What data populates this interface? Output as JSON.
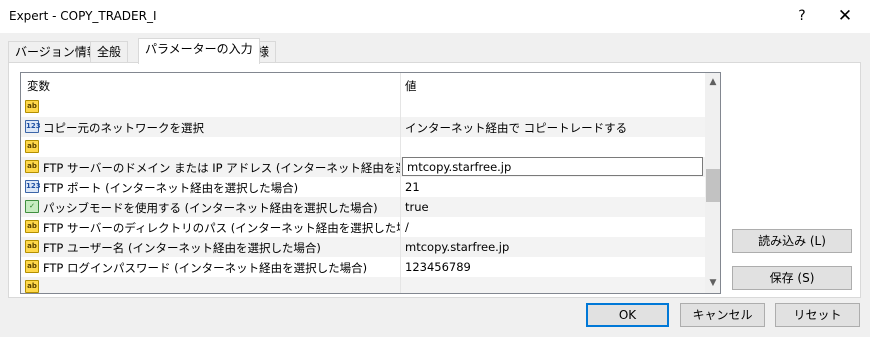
{
  "window": {
    "title": "Expert - COPY_TRADER_I",
    "help": "?",
    "close": "✕"
  },
  "tabs": [
    {
      "label": "バージョン情報"
    },
    {
      "label": "全般"
    },
    {
      "label": "パラメーターの入力"
    },
    {
      "label": "仕様"
    }
  ],
  "grid": {
    "columns": {
      "name": "変数",
      "value": "値"
    },
    "rows": [
      {
        "icon": "string-icon",
        "name": "",
        "value": ""
      },
      {
        "icon": "integer-icon",
        "name": "コピー元のネットワークを選択",
        "value": "インターネット経由で コピートレードする"
      },
      {
        "icon": "string-icon",
        "name": "",
        "value": ""
      },
      {
        "icon": "string-icon",
        "name": "FTP サーバーのドメイン または IP アドレス (インターネット経由を選択した場合)",
        "value": "mtcopy.starfree.jp"
      },
      {
        "icon": "integer-icon",
        "name": "FTP ポート (インターネット経由を選択した場合)",
        "value": "21"
      },
      {
        "icon": "bool-icon",
        "name": "パッシブモードを使用する (インターネット経由を選択した場合)",
        "value": "true"
      },
      {
        "icon": "string-icon",
        "name": "FTP サーバーのディレクトリのパス (インターネット経由を選択した場合)",
        "value": "/"
      },
      {
        "icon": "string-icon",
        "name": "FTP ユーザー名 (インターネット経由を選択した場合)",
        "value": "mtcopy.starfree.jp"
      },
      {
        "icon": "string-icon",
        "name": "FTP ログインパスワード (インターネット経由を選択した場合)",
        "value": "123456789"
      },
      {
        "icon": "string-icon",
        "name": "",
        "value": ""
      }
    ],
    "icon_glyphs": {
      "string": "ab",
      "integer": "123",
      "bool": "✓"
    }
  },
  "side_buttons": {
    "load": "読み込み (L)",
    "save": "保存 (S)"
  },
  "footer": {
    "ok": "OK",
    "cancel": "キャンセル",
    "reset": "リセット"
  },
  "scrollbar": {
    "up": "▲",
    "down": "▼"
  }
}
